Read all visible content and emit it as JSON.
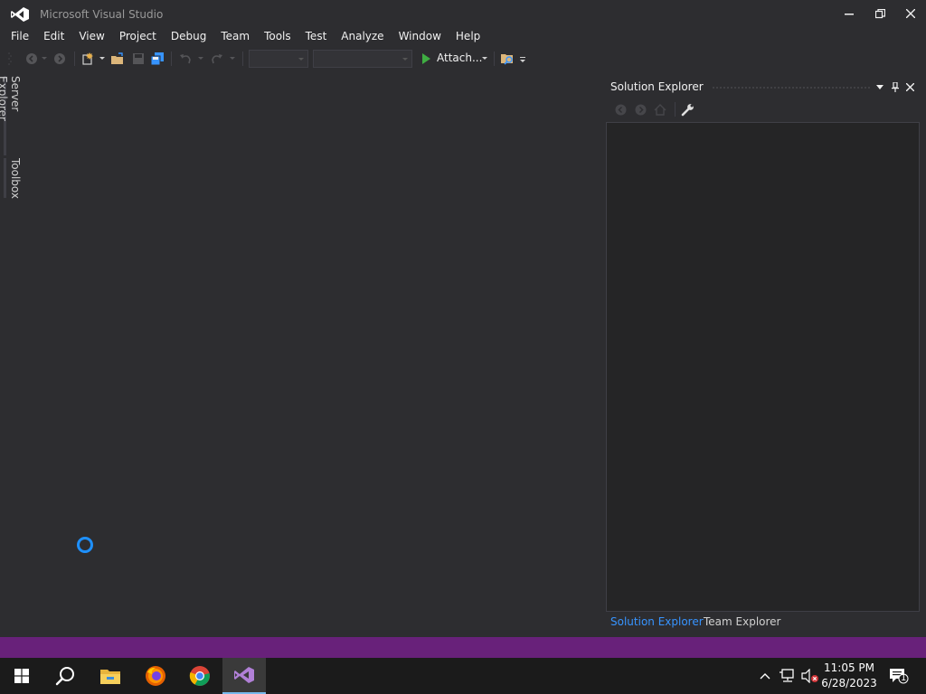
{
  "window": {
    "title": "Microsoft Visual Studio"
  },
  "menu": {
    "items": [
      "File",
      "Edit",
      "View",
      "Project",
      "Debug",
      "Team",
      "Tools",
      "Test",
      "Analyze",
      "Window",
      "Help"
    ]
  },
  "toolbar": {
    "attach_label": "Attach...",
    "solution_config_value": "",
    "solution_platform_value": ""
  },
  "left_tabs": {
    "server_explorer": "Server Explorer",
    "toolbox": "Toolbox"
  },
  "solution_explorer": {
    "title": "Solution Explorer",
    "tabs": [
      "Solution Explorer",
      "Team Explorer"
    ]
  },
  "taskbar": {
    "time": "11:05 PM",
    "date": "6/28/2023",
    "notification_count": "1"
  },
  "colors": {
    "accent_purple": "#68217a",
    "active_tab_blue": "#3794ff",
    "spinner_blue": "#1e90ff",
    "background": "#2d2d30"
  },
  "icons": [
    "vs-logo-icon",
    "minimize-icon",
    "restore-icon",
    "close-icon",
    "back-icon",
    "forward-icon",
    "new-project-icon",
    "open-file-icon",
    "save-icon",
    "save-all-icon",
    "undo-icon",
    "redo-icon",
    "start-debug-icon",
    "find-in-files-icon",
    "pin-icon",
    "home-icon",
    "properties-wrench-icon",
    "windows-start-icon",
    "search-icon",
    "file-explorer-icon",
    "firefox-icon",
    "chrome-icon",
    "visual-studio-icon",
    "chevron-up-icon",
    "network-icon",
    "volume-muted-icon",
    "notification-icon"
  ]
}
